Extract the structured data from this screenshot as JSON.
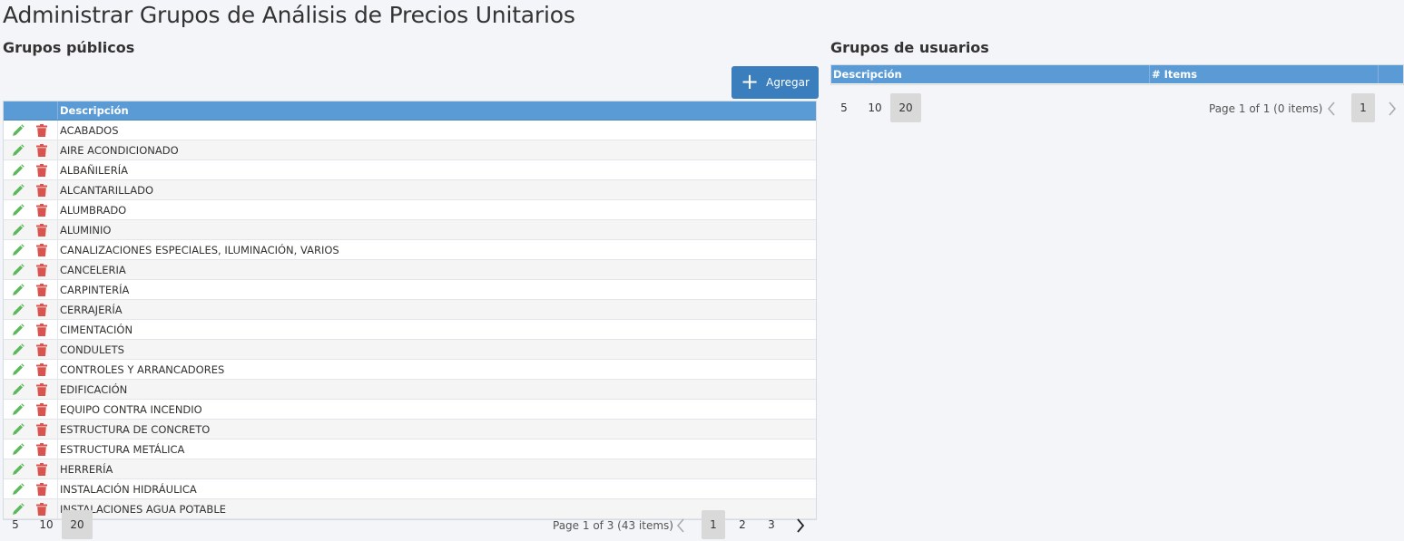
{
  "page": {
    "title": "Administrar Grupos de Análisis de Precios Unitarios"
  },
  "public_groups": {
    "title": "Grupos públicos",
    "add_label": "Agregar",
    "columns": {
      "description": "Descripción"
    },
    "rows": [
      "ACABADOS",
      "AIRE ACONDICIONADO",
      "ALBAÑILERÍA",
      "ALCANTARILLADO",
      "ALUMBRADO",
      "ALUMINIO",
      "CANALIZACIONES ESPECIALES, ILUMINACIÓN, VARIOS",
      "CANCELERIA",
      "CARPINTERÍA",
      "CERRAJERÍA",
      "CIMENTACIÓN",
      "CONDULETS",
      "CONTROLES Y ARRANCADORES",
      "EDIFICACIÓN",
      "EQUIPO CONTRA INCENDIO",
      "ESTRUCTURA DE CONCRETO",
      "ESTRUCTURA METÁLICA",
      "HERRERÍA",
      "INSTALACIÓN HIDRÁULICA",
      "INSTALACIONES AGUA POTABLE"
    ],
    "pager": {
      "sizes": [
        "5",
        "10",
        "20"
      ],
      "active_size": "20",
      "info": "Page 1 of 3 (43 items)",
      "pages": [
        "1",
        "2",
        "3"
      ],
      "active_page": "1"
    }
  },
  "user_groups": {
    "title": "Grupos de usuarios",
    "columns": {
      "description": "Descripción",
      "items": "# Items"
    },
    "pager": {
      "sizes": [
        "5",
        "10",
        "20"
      ],
      "active_size": "20",
      "info": "Page 1 of 1 (0 items)",
      "pages": [
        "1"
      ],
      "active_page": "1"
    }
  },
  "colors": {
    "header_blue": "#5b9bd5",
    "button_blue": "#3a7ebd",
    "edit_green": "#5cb85c",
    "delete_red": "#d9534f"
  },
  "icons": {
    "edit": "pencil-icon",
    "delete": "trash-icon",
    "add": "plus-icon",
    "prev": "chevron-left-icon",
    "next": "chevron-right-icon"
  }
}
